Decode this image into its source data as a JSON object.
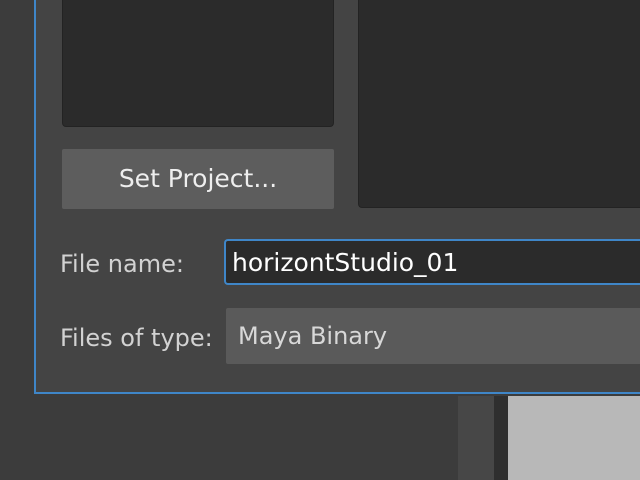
{
  "dialog": {
    "set_project_label": "Set Project...",
    "file_name": {
      "label": "File name:",
      "value": "horizontStudio_01"
    },
    "files_of_type": {
      "label": "Files of type:",
      "selected": "Maya Binary"
    }
  },
  "colors": {
    "accent": "#3f86c8",
    "dialog_bg": "#444444",
    "panel_bg": "#2b2b2b",
    "button_bg": "#5d5d5d"
  }
}
